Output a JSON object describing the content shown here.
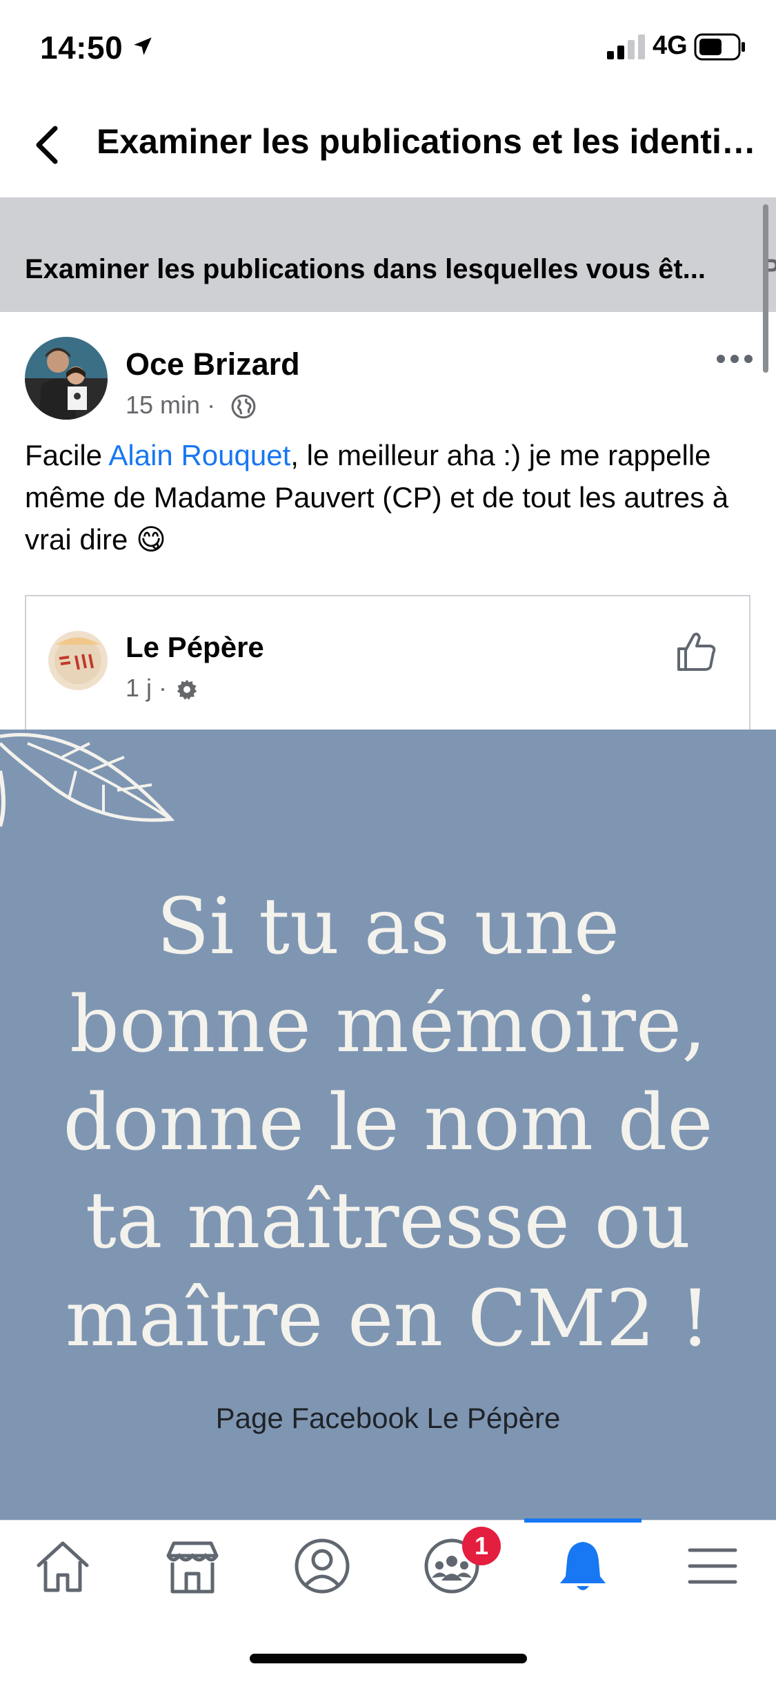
{
  "status_bar": {
    "time": "14:50",
    "network": "4G"
  },
  "nav": {
    "title": "Examiner les publications et les identif..."
  },
  "banner": {
    "text": "Examiner les publications dans lesquelles vous êt...",
    "next_tab_peek": "P"
  },
  "post": {
    "author": "Oce Brizard",
    "time": "15 min",
    "separator": "·",
    "text_before": "Facile ",
    "mention": "Alain Rouquet",
    "text_after": ", le meilleur aha :) je me rappelle même de Madame Pauvert (CP) et de tout les autres à vrai dire ",
    "emoji": "😋",
    "shared": {
      "page_name": "Le Pépère",
      "time": "1 j",
      "separator": "·",
      "avatar_text": "LE PÉPÈRE",
      "image_lines": [
        "Si tu as une",
        "bonne mémoire,",
        "donne le nom de",
        "ta maîtresse ou",
        "maître en CM2 !"
      ],
      "image_caption": "Page Facebook Le Pépère"
    }
  },
  "tabbar": {
    "items": [
      "home-icon",
      "marketplace-icon",
      "profile-icon",
      "groups-icon",
      "notifications-icon",
      "menu-icon"
    ],
    "groups_badge": "1",
    "active": "notifications-icon"
  },
  "colors": {
    "accent": "#1877f2",
    "badge": "#e41e3f",
    "band": "#ced0d4",
    "image_bg": "#7f96b2"
  }
}
